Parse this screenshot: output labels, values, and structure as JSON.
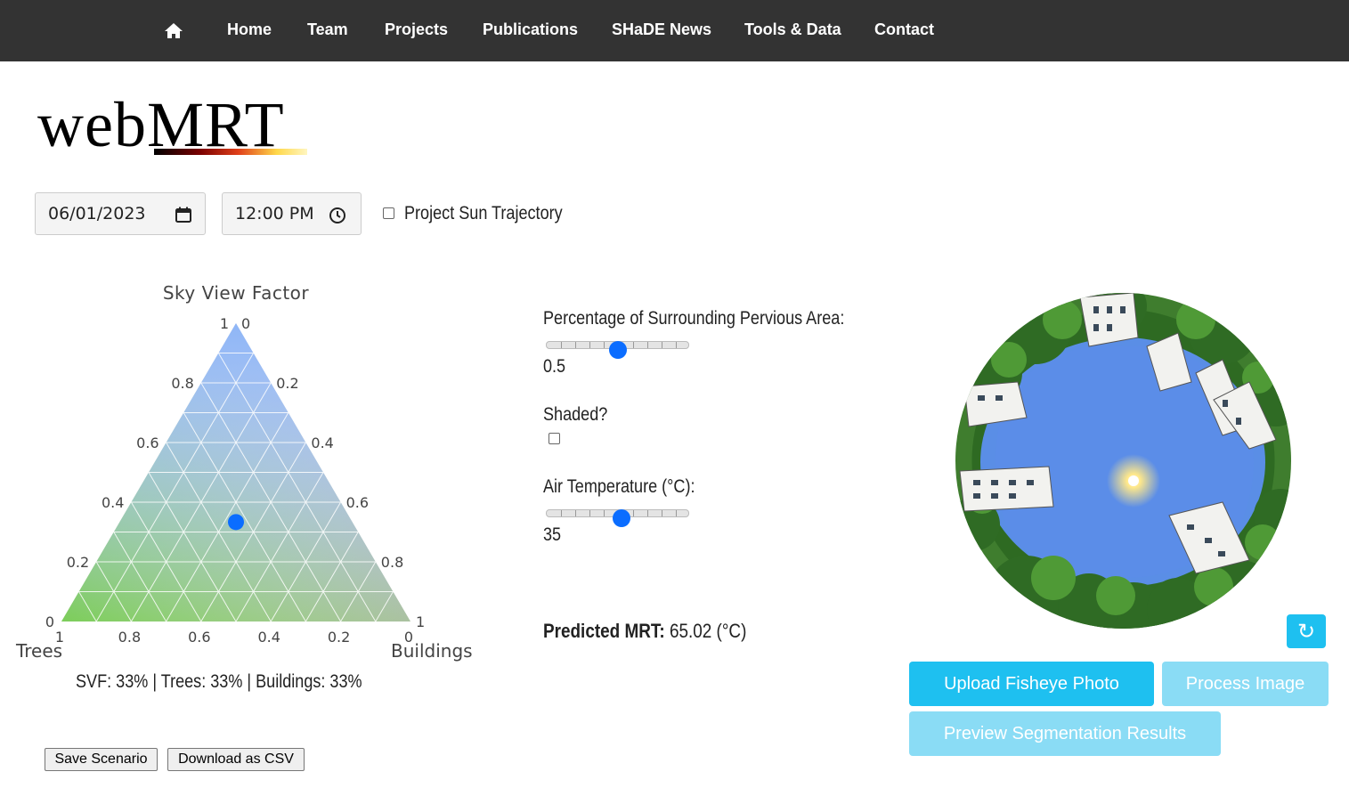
{
  "nav": {
    "home_icon": "home-icon",
    "items": [
      {
        "label": "Home"
      },
      {
        "label": "Team"
      },
      {
        "label": "Projects"
      },
      {
        "label": "Publications"
      },
      {
        "label": "SHaDE News"
      },
      {
        "label": "Tools & Data"
      },
      {
        "label": "Contact"
      }
    ]
  },
  "logo": {
    "text_web": "web",
    "text_mrt": "MRT"
  },
  "controls": {
    "date_value": "06/01/2023",
    "time_value": "12:00 PM",
    "project_sun_label": "Project Sun Trajectory",
    "project_sun_checked": false
  },
  "ternary": {
    "title": "Sky View Factor",
    "axis_trees": "Trees",
    "axis_buildings": "Buildings",
    "left_ticks": [
      "0",
      "0.2",
      "0.4",
      "0.6",
      "0.8",
      "1"
    ],
    "right_ticks": [
      "0",
      "0.2",
      "0.4",
      "0.6",
      "0.8",
      "1"
    ],
    "bottom_ticks": [
      "1",
      "0.8",
      "0.6",
      "0.4",
      "0.2",
      "0"
    ],
    "point": {
      "svf": 0.33,
      "trees": 0.33,
      "buildings": 0.33
    },
    "summary": "SVF: 33%  |  Trees: 33%  |  Buildings: 33%"
  },
  "params": {
    "pervious_label": "Percentage of Surrounding Pervious Area:",
    "pervious_value": "0.5",
    "pervious_fraction": 0.5,
    "shaded_label": "Shaded?",
    "shaded_checked": false,
    "airtemp_label": "Air Temperature (°C):",
    "airtemp_value": "35",
    "airtemp_fraction": 0.53
  },
  "result": {
    "label": "Predicted MRT:",
    "value": "65.02 (°C)"
  },
  "buttons": {
    "save": "Save Scenario",
    "download": "Download as CSV",
    "upload": "Upload Fisheye Photo",
    "process": "Process Image",
    "preview": "Preview Segmentation Results",
    "refresh_icon": "refresh-icon"
  },
  "colors": {
    "nav_bg": "#333333",
    "primary": "#1ec0f0",
    "primary_disabled": "#8adcf5",
    "thumb": "#0b6dff"
  }
}
